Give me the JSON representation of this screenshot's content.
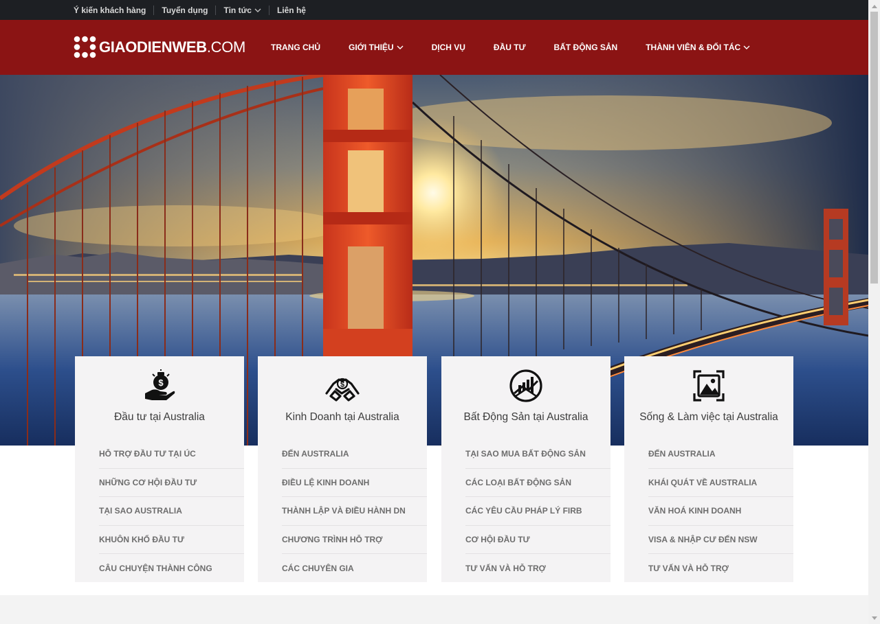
{
  "topbar": {
    "links": [
      {
        "label": "Ý kiến khách hàng"
      },
      {
        "label": "Tuyển dụng"
      },
      {
        "label": "Tin tức",
        "has_dropdown": true
      },
      {
        "label": "Liên hệ"
      }
    ]
  },
  "header": {
    "logo_bold": "GIAODIENWEB",
    "logo_light": ".COM",
    "nav": [
      {
        "label": "TRANG CHỦ"
      },
      {
        "label": "GIỚI THIỆU",
        "has_dropdown": true
      },
      {
        "label": "DỊCH VỤ"
      },
      {
        "label": "ĐẦU TƯ"
      },
      {
        "label": "BẤT ĐỘNG SẢN"
      },
      {
        "label": "THÀNH VIÊN & ĐỐI TÁC",
        "has_dropdown": true
      }
    ]
  },
  "cards": [
    {
      "icon": "money-bag-hand-icon",
      "title": "Đầu tư tại Australia",
      "links": [
        "HỖ TRỢ ĐẦU TƯ TẠI ÚC",
        "NHỮNG CƠ HỘI ĐẦU TƯ",
        "TẠI SAO AUSTRALIA",
        "KHUÔN KHỔ ĐẦU TƯ",
        "CÂU CHUYỆN THÀNH CÔNG"
      ]
    },
    {
      "icon": "handshake-dollar-icon",
      "title": "Kinh Doanh tại Australia",
      "links": [
        "ĐẾN AUSTRALIA",
        "ĐIỀU LỆ KINH DOANH",
        "THÀNH LẬP VÀ ĐIỀU HÀNH DN",
        "CHƯƠNG TRÌNH HỖ TRỢ",
        "CÁC CHUYÊN GIA"
      ]
    },
    {
      "icon": "real-estate-chart-icon",
      "title": "Bất Động Sản tại Australia",
      "links": [
        "TẠI SAO MUA BẤT ĐỘNG SẢN",
        "CÁC LOẠI BẤT ĐỘNG SẢN",
        "CÁC YÊU CẦU PHÁP LÝ FIRB",
        "CƠ HỘI ĐẦU TƯ",
        "TƯ VẤN VÀ HỖ TRỢ"
      ]
    },
    {
      "icon": "image-frame-icon",
      "title": "Sống & Làm việc tại Australia",
      "links": [
        "ĐẾN AUSTRALIA",
        "KHÁI QUÁT VỀ AUSTRALIA",
        "VĂN HOÁ KINH DOANH",
        "VISA & NHẬP CƯ ĐẾN NSW",
        "TƯ VẤN VÀ HỖ TRỢ"
      ]
    }
  ],
  "colors": {
    "topbar_bg": "#1d1f23",
    "header_bg": "#8b1414",
    "card_bg": "#f4f3f4"
  }
}
